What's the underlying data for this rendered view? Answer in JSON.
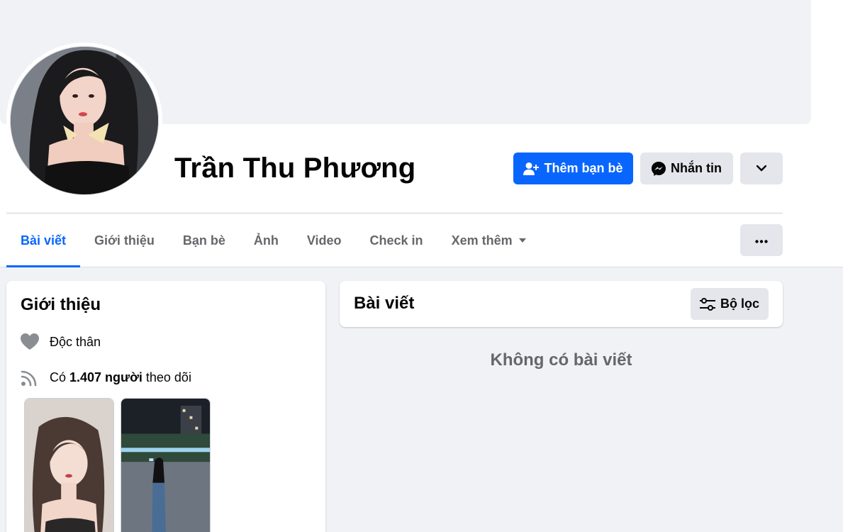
{
  "profile": {
    "name": "Trần Thu Phương"
  },
  "actions": {
    "add_friend": "Thêm bạn bè",
    "message": "Nhắn tin"
  },
  "tabs": [
    {
      "label": "Bài viết",
      "active": true
    },
    {
      "label": "Giới thiệu"
    },
    {
      "label": "Bạn bè"
    },
    {
      "label": "Ảnh"
    },
    {
      "label": "Video"
    },
    {
      "label": "Check in"
    },
    {
      "label": "Xem thêm"
    }
  ],
  "intro": {
    "title": "Giới thiệu",
    "relationship": "Độc thân",
    "followers_prefix": "Có ",
    "followers_count": "1.407 người",
    "followers_suffix": " theo dõi"
  },
  "posts": {
    "title": "Bài viết",
    "filter_label": "Bộ lọc",
    "empty_message": "Không có bài viết"
  },
  "colors": {
    "primary": "#0866ff",
    "button_gray": "#e4e6eb",
    "background": "#f0f2f5",
    "secondary_text": "#65676b"
  },
  "icons": {
    "add_friend": "add-person-icon",
    "message": "messenger-icon",
    "more": "chevron-down-icon",
    "menu": "more-dots-icon",
    "relationship": "heart-icon",
    "followers": "rss-feed-icon",
    "filter": "sliders-icon"
  }
}
